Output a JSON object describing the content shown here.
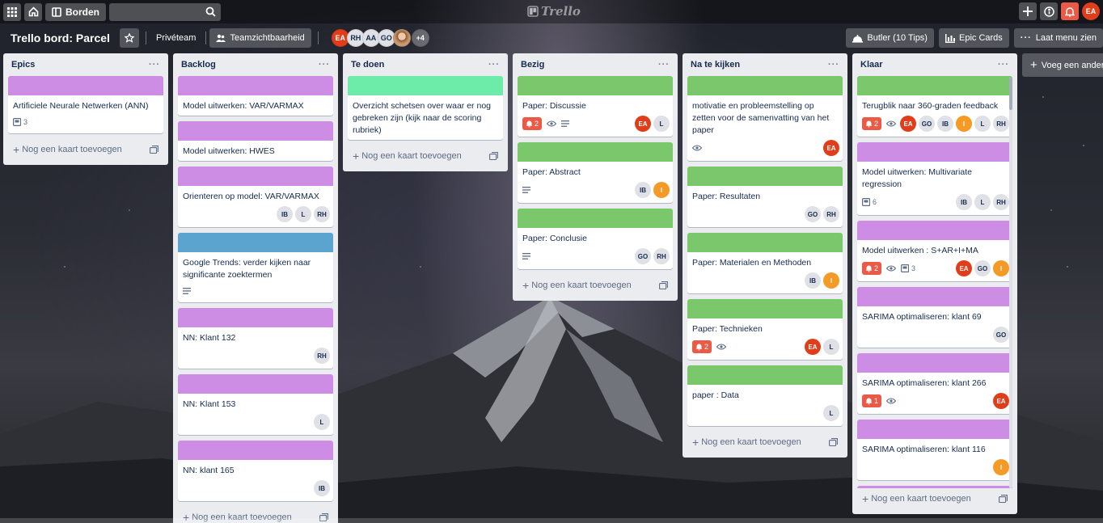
{
  "topbar": {
    "boards_label": "Borden",
    "logo_text": "Trello",
    "user_initials": "EA"
  },
  "header": {
    "board_title": "Trello bord: Parcel",
    "team_label": "Privéteam",
    "visibility_label": "Teamzichtbaarheid",
    "members": [
      "EA",
      "RH",
      "AA",
      "GO"
    ],
    "members_more": "+4",
    "butler_label": "Butler (10 Tips)",
    "epic_cards_label": "Epic Cards",
    "menu_label": "Laat menu zien"
  },
  "add_list_label": "Voeg een andere lijst toe",
  "colors": {
    "purple": "#c377e0",
    "green": "#61bd4f",
    "teal": "#51e898",
    "blue": "#0079bf"
  },
  "lists": [
    {
      "name": "Epics",
      "add_label": "Nog een kaart toevoegen",
      "cards": [
        {
          "cover": "#cd8de5",
          "title": "Artificiele Neurale Netwerken (ANN)",
          "checklist": "3",
          "members": []
        }
      ]
    },
    {
      "name": "Backlog",
      "add_label": "Nog een kaart toevoegen",
      "cards": [
        {
          "cover": "#cd8de5",
          "title": "Model uitwerken: VAR/VARMAX",
          "members": []
        },
        {
          "cover": "#cd8de5",
          "title": "Model uitwerken: HWES",
          "members": []
        },
        {
          "cover": "#cd8de5",
          "title": "Orienteren op model: VAR/VARMAX",
          "members": [
            "IB",
            "L",
            "RH"
          ]
        },
        {
          "cover": "#5ba4cf",
          "title": "Google Trends: verder kijken naar significante zoektermen",
          "description": true,
          "members": []
        },
        {
          "cover": "#cd8de5",
          "title": "NN: Klant 132",
          "members": [
            "RH"
          ]
        },
        {
          "cover": "#cd8de5",
          "title": "NN: Klant 153",
          "members": [
            "L"
          ]
        },
        {
          "cover": "#cd8de5",
          "title": "NN: klant 165",
          "members": [
            "IB"
          ]
        }
      ]
    },
    {
      "name": "Te doen",
      "add_label": "Nog een kaart toevoegen",
      "cards": [
        {
          "cover": "#6deca9",
          "title": "Overzicht schetsen over waar er nog gebreken zijn (kijk naar de scoring rubriek)",
          "members": []
        }
      ]
    },
    {
      "name": "Bezig",
      "add_label": "Nog een kaart toevoegen",
      "cards": [
        {
          "cover": "#7bc86c",
          "title": "Paper: Discussie",
          "notifications": "2",
          "watch": true,
          "description": true,
          "members": [
            "EA",
            "L"
          ]
        },
        {
          "cover": "#7bc86c",
          "title": "Paper: Abstract",
          "description": true,
          "members": [
            "IB",
            "I"
          ]
        },
        {
          "cover": "#7bc86c",
          "title": "Paper: Conclusie",
          "description": true,
          "members": [
            "GO",
            "RH"
          ]
        }
      ]
    },
    {
      "name": "Na te kijken",
      "add_label": "Nog een kaart toevoegen",
      "cards": [
        {
          "cover": "#7bc86c",
          "title": "motivatie en probleemstelling op zetten voor de samenvatting van het paper",
          "watch": true,
          "members": [
            "EA"
          ]
        },
        {
          "cover": "#7bc86c",
          "title": "Paper: Resultaten",
          "members": [
            "GO",
            "RH"
          ]
        },
        {
          "cover": "#7bc86c",
          "title": "Paper: Materialen en Methoden",
          "members": [
            "IB",
            "I"
          ]
        },
        {
          "cover": "#7bc86c",
          "title": "Paper: Technieken",
          "notifications": "2",
          "watch": true,
          "members": [
            "EA",
            "L"
          ]
        },
        {
          "cover": "#7bc86c",
          "title": "paper : Data",
          "members": [
            "L"
          ]
        }
      ]
    },
    {
      "name": "Klaar",
      "add_label": "Nog een kaart toevoegen",
      "cards": [
        {
          "cover": "#7bc86c",
          "title": "Terugblik naar 360-graden feedback",
          "notifications": "2",
          "watch": true,
          "members": [
            "EA",
            "GO",
            "IB",
            "I",
            "L",
            "RH"
          ]
        },
        {
          "cover": "#cd8de5",
          "title": "Model uitwerken: Multivariate regression",
          "checklist": "6",
          "members": [
            "IB",
            "L",
            "RH"
          ]
        },
        {
          "cover": "#cd8de5",
          "title": "Model uitwerken : S+AR+I+MA",
          "notifications": "2",
          "watch": true,
          "checklist": "3",
          "members": [
            "EA",
            "GO",
            "I"
          ]
        },
        {
          "cover": "#cd8de5",
          "title": "SARIMA optimaliseren: klant 69",
          "members": [
            "GO"
          ]
        },
        {
          "cover": "#cd8de5",
          "title": "SARIMA optimaliseren: klant 266",
          "notifications": "1",
          "watch": true,
          "members": [
            "EA"
          ]
        },
        {
          "cover": "#cd8de5",
          "title": "SARIMA optimaliseren: klant 116",
          "members": [
            "I"
          ]
        },
        {
          "cover": "#cd8de5",
          "title": "",
          "members": []
        }
      ]
    }
  ]
}
